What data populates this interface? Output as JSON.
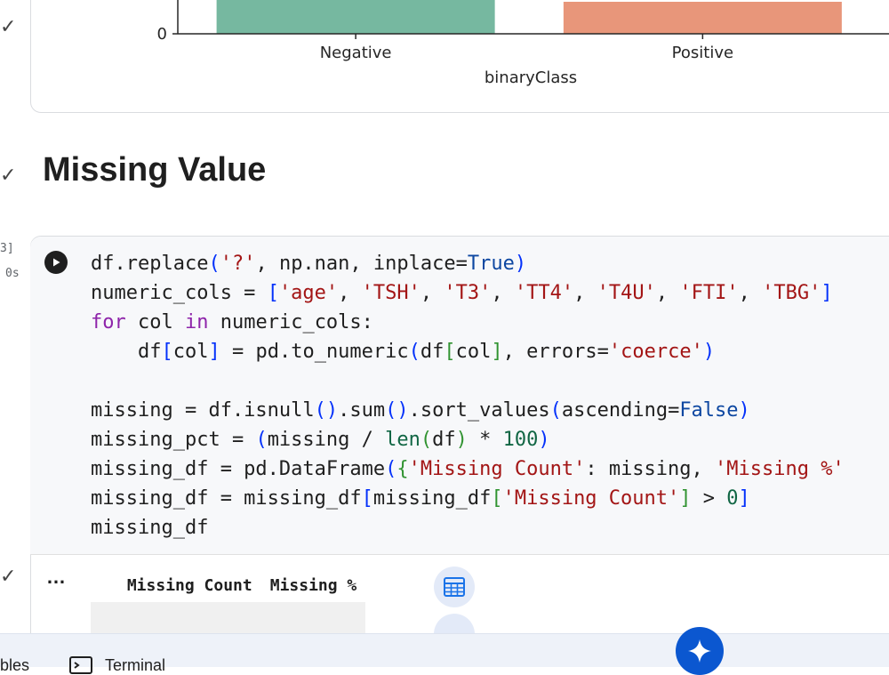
{
  "chart_data": {
    "type": "bar",
    "categories": [
      "Negative",
      "Positive"
    ],
    "values": [
      null,
      null
    ],
    "xlabel": "binaryClass",
    "ylabel": "",
    "y_tick_labels": [
      "0"
    ],
    "colors": [
      "#76b8a0",
      "#e8967a"
    ]
  },
  "section": {
    "title": "Missing Value"
  },
  "code_cell": {
    "execution_count": "3]",
    "execution_time": "0s",
    "lines": [
      [
        [
          "df.replace",
          ""
        ],
        [
          "(",
          "br1"
        ],
        [
          "'?'",
          "st"
        ],
        [
          ", np.nan, inplace=",
          ""
        ],
        [
          "True",
          "bl"
        ],
        [
          ")",
          "br1"
        ]
      ],
      [
        [
          "numeric_cols = ",
          ""
        ],
        [
          "[",
          "br1"
        ],
        [
          "'age'",
          "st"
        ],
        [
          ", ",
          ""
        ],
        [
          "'TSH'",
          "st"
        ],
        [
          ", ",
          ""
        ],
        [
          "'T3'",
          "st"
        ],
        [
          ", ",
          ""
        ],
        [
          "'TT4'",
          "st"
        ],
        [
          ", ",
          ""
        ],
        [
          "'T4U'",
          "st"
        ],
        [
          ", ",
          ""
        ],
        [
          "'FTI'",
          "st"
        ],
        [
          ", ",
          ""
        ],
        [
          "'TBG'",
          "st"
        ],
        [
          "]",
          "br1"
        ]
      ],
      [
        [
          "for",
          "kw"
        ],
        [
          " col ",
          ""
        ],
        [
          "in",
          "kw"
        ],
        [
          " numeric_cols:",
          ""
        ]
      ],
      [
        [
          "    df",
          ""
        ],
        [
          "[",
          "br1"
        ],
        [
          "col",
          ""
        ],
        [
          "]",
          "br1"
        ],
        [
          " = pd.to_numeric",
          ""
        ],
        [
          "(",
          "br1"
        ],
        [
          "df",
          ""
        ],
        [
          "[",
          "br2"
        ],
        [
          "col",
          ""
        ],
        [
          "]",
          "br2"
        ],
        [
          ", errors=",
          ""
        ],
        [
          "'coerce'",
          "st"
        ],
        [
          ")",
          "br1"
        ]
      ],
      [
        [
          "",
          ""
        ]
      ],
      [
        [
          "missing = df.isnull",
          ""
        ],
        [
          "()",
          "br1"
        ],
        [
          ".sum",
          ""
        ],
        [
          "()",
          "br1"
        ],
        [
          ".sort_values",
          ""
        ],
        [
          "(",
          "br1"
        ],
        [
          "ascending=",
          ""
        ],
        [
          "False",
          "bl"
        ],
        [
          ")",
          "br1"
        ]
      ],
      [
        [
          "missing_pct = ",
          ""
        ],
        [
          "(",
          "br1"
        ],
        [
          "missing / ",
          ""
        ],
        [
          "len",
          "nm"
        ],
        [
          "(",
          "br2"
        ],
        [
          "df",
          ""
        ],
        [
          ")",
          "br2"
        ],
        [
          " * ",
          ""
        ],
        [
          "100",
          "nm"
        ],
        [
          ")",
          "br1"
        ]
      ],
      [
        [
          "missing_df = pd.DataFrame",
          ""
        ],
        [
          "(",
          "br1"
        ],
        [
          "{",
          "br2"
        ],
        [
          "'Missing Count'",
          "st"
        ],
        [
          ": missing, ",
          ""
        ],
        [
          "'Missing %'",
          "st"
        ]
      ],
      [
        [
          "missing_df = missing_df",
          ""
        ],
        [
          "[",
          "br1"
        ],
        [
          "missing_df",
          ""
        ],
        [
          "[",
          "br2"
        ],
        [
          "'Missing Count'",
          "st"
        ],
        [
          "]",
          "br2"
        ],
        [
          " > ",
          ""
        ],
        [
          "0",
          "nm"
        ],
        [
          "]",
          "br1"
        ]
      ],
      [
        [
          "missing_df",
          ""
        ]
      ]
    ]
  },
  "output": {
    "menu_label": "…",
    "table": {
      "columns": [
        "",
        "Missing Count",
        "Missing %"
      ]
    }
  },
  "bottom_bar": {
    "variables_tab": "bles",
    "terminal_tab": "Terminal"
  },
  "icons": {
    "run": "play-icon",
    "table_view": "table-icon",
    "gemini": "sparkle-icon",
    "terminal": "terminal-icon"
  }
}
